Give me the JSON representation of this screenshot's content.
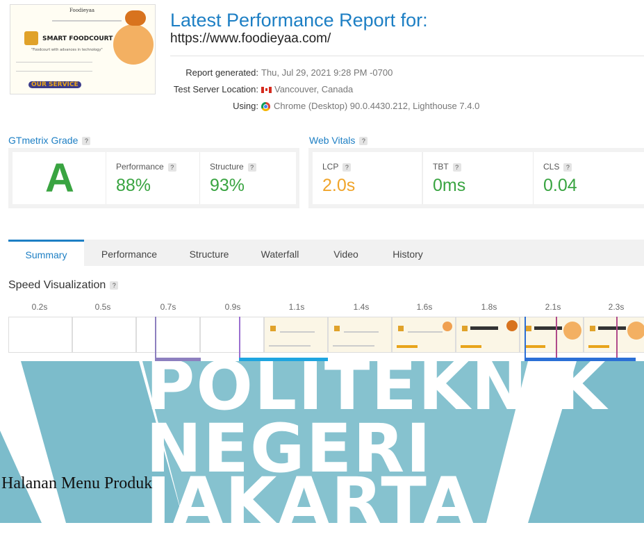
{
  "report": {
    "title": "Latest Performance Report for:",
    "url": "https://www.foodieyaa.com/",
    "generated_label": "Report generated:",
    "generated_value": "Thu, Jul 29, 2021 9:28 PM -0700",
    "location_label": "Test Server Location:",
    "location_value": "Vancouver, Canada",
    "using_label": "Using:",
    "using_value": "Chrome (Desktop) 90.0.4430.212, Lighthouse 7.4.0",
    "thumbnail": {
      "brand": "Foodieyaa",
      "headline": "SMART FOODCOURT",
      "tagline": "\"Foodcourt with advances in technology\"",
      "button": "OUR SERVICE"
    }
  },
  "grade": {
    "section_title": "GTmetrix Grade",
    "letter": "A",
    "performance_label": "Performance",
    "performance_value": "88%",
    "structure_label": "Structure",
    "structure_value": "93%"
  },
  "vitals": {
    "section_title": "Web Vitals",
    "lcp_label": "LCP",
    "lcp_value": "2.0s",
    "tbt_label": "TBT",
    "tbt_value": "0ms",
    "cls_label": "CLS",
    "cls_value": "0.04"
  },
  "help_badge": "?",
  "tabs": [
    "Summary",
    "Performance",
    "Structure",
    "Waterfall",
    "Video",
    "History"
  ],
  "active_tab": "Summary",
  "speed": {
    "title": "Speed Visualization",
    "times": [
      "0.2s",
      "0.5s",
      "0.7s",
      "0.9s",
      "1.1s",
      "1.4s",
      "1.6s",
      "1.8s",
      "2.1s",
      "2.3s"
    ]
  },
  "watermark": {
    "line1": "POLITEKNIK",
    "line2": "NEGERI",
    "line3": "JAKARTA"
  },
  "caption": "Halanan Menu Produk",
  "colors": {
    "accent": "#1d7fc4",
    "good": "#39a441",
    "warn": "#f0a42a",
    "watermark_teal": "#76b9c8"
  }
}
